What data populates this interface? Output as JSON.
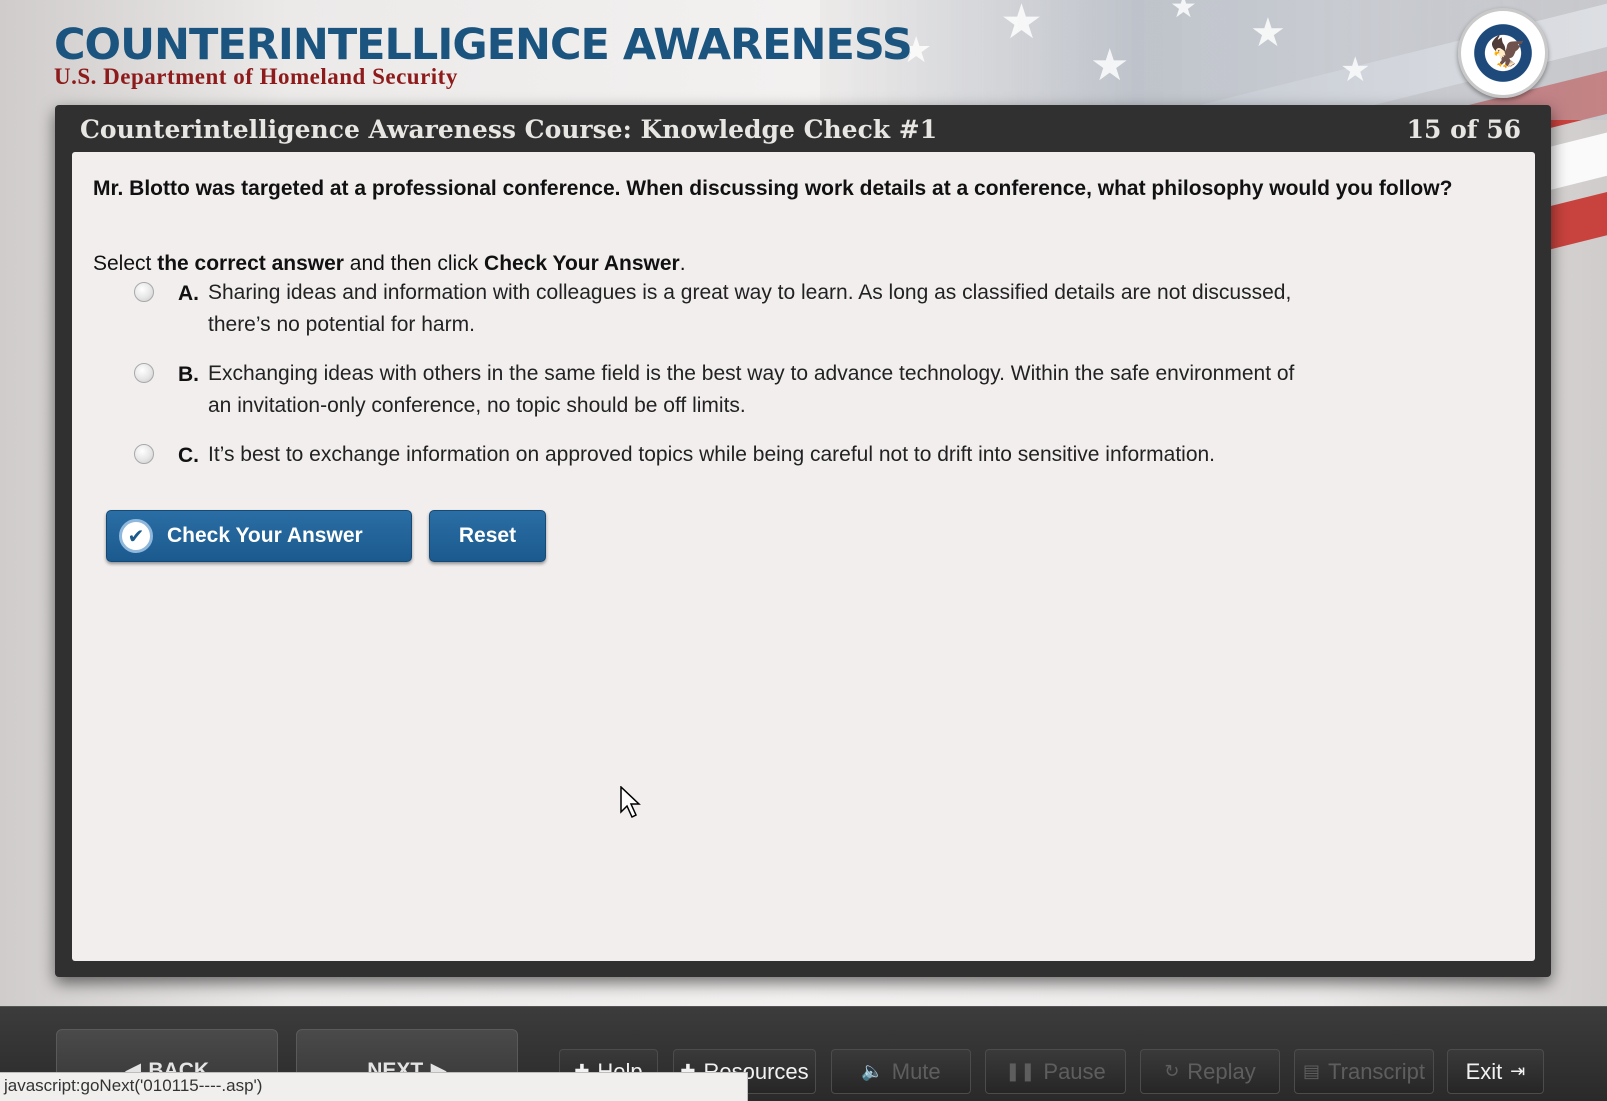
{
  "header": {
    "title": "COUNTERINTELLIGENCE AWARENESS",
    "subtitle": "U.S. Department of Homeland Security",
    "seal_icon": "dhs-seal-icon"
  },
  "panel": {
    "title": "Counterintelligence Awareness Course: Knowledge Check #1",
    "page_indicator": "15 of 56"
  },
  "question": {
    "text": "Mr. Blotto was targeted at a professional conference.  When discussing work details at a conference, what philosophy would you follow?",
    "instruction_prefix": "Select ",
    "instruction_bold1": "the correct answer",
    "instruction_mid": " and then click ",
    "instruction_bold2": "Check Your Answer",
    "instruction_suffix": "."
  },
  "options": [
    {
      "letter": "A.",
      "text": "Sharing ideas and information with colleagues is a great way to learn. As long as classified details are not discussed, there’s no potential for harm.",
      "selected": false
    },
    {
      "letter": "B.",
      "text": "Exchanging ideas with others in the same field is the best way to advance technology. Within the safe environment of an invitation-only conference, no topic should be off limits.",
      "selected": false
    },
    {
      "letter": "C.",
      "text": "It’s best to exchange information on approved topics while being careful not to drift into sensitive information.",
      "selected": false
    }
  ],
  "buttons": {
    "check_answer": "Check Your Answer",
    "reset": "Reset"
  },
  "bottom_bar": {
    "back": "BACK",
    "next": "NEXT",
    "help": "Help",
    "resources": "Resources",
    "mute": "Mute",
    "pause": "Pause",
    "replay": "Replay",
    "transcript": "Transcript",
    "exit": "Exit"
  },
  "status_bar": {
    "text": "javascript:goNext('010115----.asp')"
  },
  "colors": {
    "title_blue": "#1b557f",
    "subtitle_red": "#8e1b1b",
    "button_blue": "#1b5a8e",
    "panel_dark": "#303030"
  }
}
